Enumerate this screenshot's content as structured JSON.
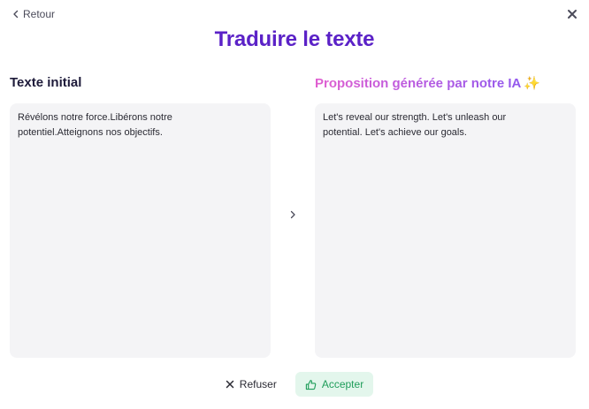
{
  "header": {
    "back_label": "Retour",
    "title": "Traduire le texte"
  },
  "left": {
    "title": "Texte initial",
    "text": "Révélons notre force.Libérons notre\npotentiel.Atteignons nos objectifs."
  },
  "right": {
    "title": "Proposition générée par notre IA",
    "sparkle": "✨",
    "text": "Let's reveal our strength. Let's unleash our\npotential. Let's achieve our goals."
  },
  "actions": {
    "refuse_label": "Refuser",
    "accept_label": "Accepter"
  },
  "colors": {
    "title": "#5b22c7",
    "accent_gradient_start": "#e05fd0",
    "accent_gradient_end": "#8a58f0",
    "accept_text": "#1f9d5a",
    "accept_bg": "#e3f6ec"
  },
  "icons": {
    "back": "chevron-left-icon",
    "close": "close-icon",
    "arrow": "chevron-right-icon",
    "refuse": "x-icon",
    "accept": "thumbs-up-icon"
  }
}
